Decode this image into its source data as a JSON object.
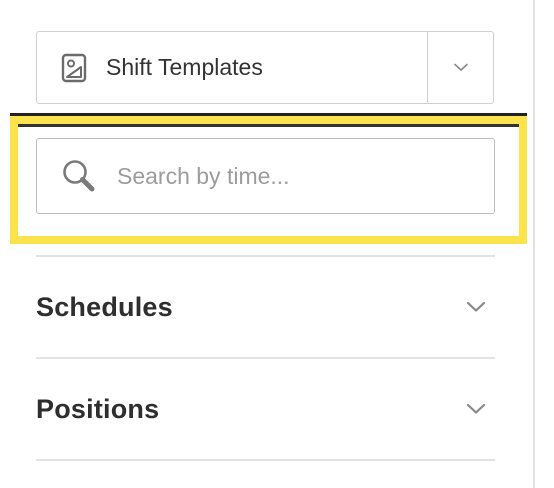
{
  "template_picker": {
    "label": "Shift Templates",
    "icon": "template-image-icon",
    "toggle_icon": "chevron-down-icon"
  },
  "search": {
    "placeholder": "Search by time...",
    "value": "",
    "icon": "search-icon",
    "highlight_color": "#fce34d"
  },
  "sections": [
    {
      "title": "Schedules",
      "icon": "chevron-down-icon"
    },
    {
      "title": "Positions",
      "icon": "chevron-down-icon"
    }
  ]
}
